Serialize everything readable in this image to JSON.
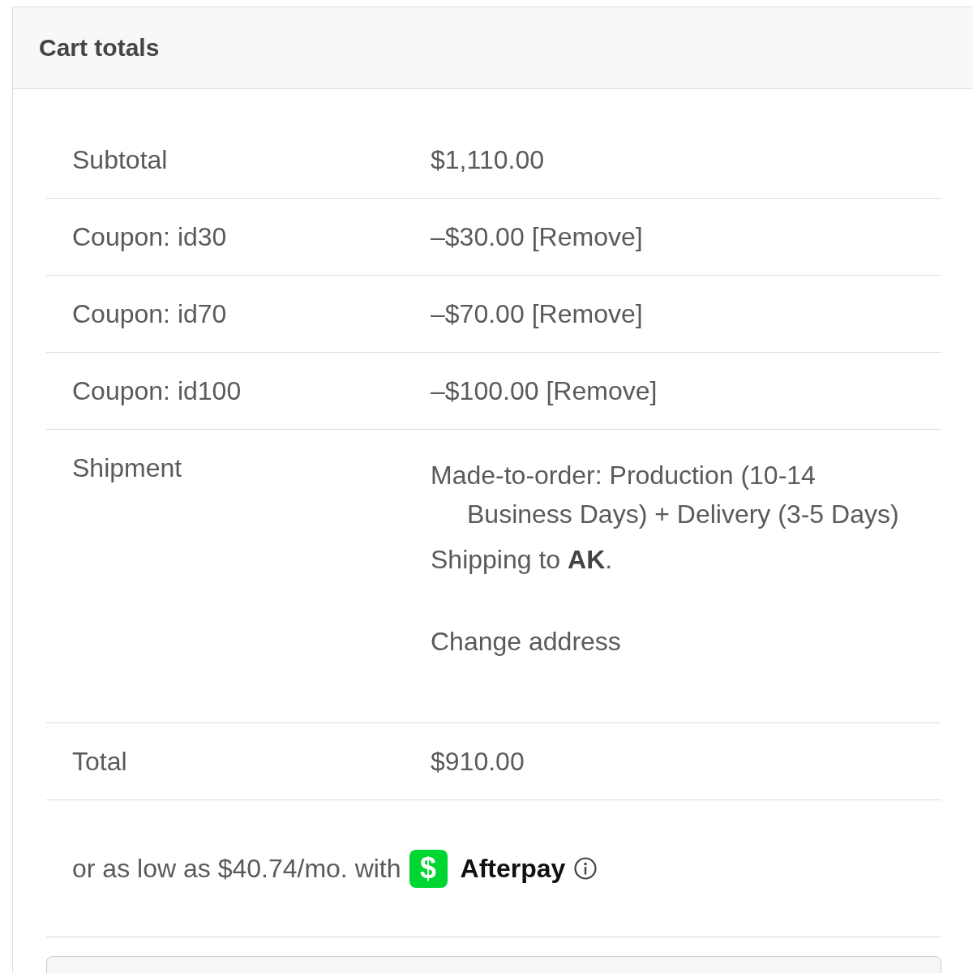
{
  "header": {
    "title": "Cart totals"
  },
  "rows": [
    {
      "kind": "amount",
      "label": "Subtotal",
      "value": "$1,110.00"
    },
    {
      "kind": "coupon",
      "label": "Coupon: id30",
      "amount": "–$30.00",
      "link": "[Remove]"
    },
    {
      "kind": "coupon",
      "label": "Coupon: id70",
      "amount": "–$70.00",
      "link": "[Remove]"
    },
    {
      "kind": "coupon",
      "label": "Coupon: id100",
      "amount": "–$100.00",
      "link": "[Remove]"
    },
    {
      "kind": "shipping",
      "label": "Shipment",
      "method": "Made-to-order: Production (10-14 Business Days) + Delivery (3-5 Days)",
      "destination": "Shipping to **AK**.",
      "link": "Change address"
    },
    {
      "kind": "amount",
      "label": "Total",
      "value": "$910.00"
    }
  ],
  "installments": {
    "text": "or as low as $40.74/mo. with",
    "logo_glyph": "$",
    "provider": "Afterpay"
  }
}
